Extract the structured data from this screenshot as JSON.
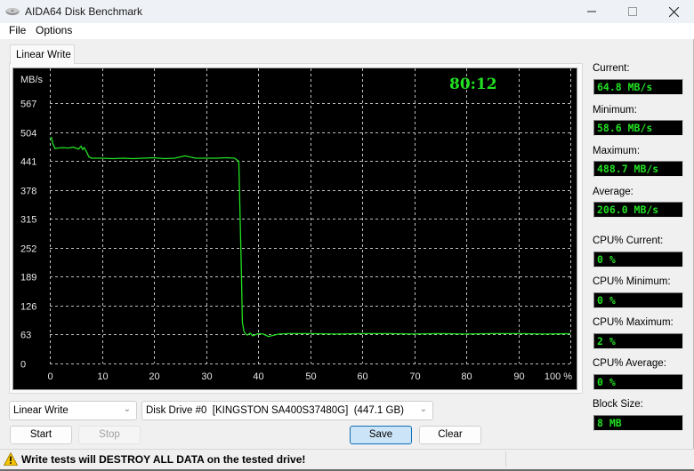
{
  "window": {
    "title": "AIDA64 Disk Benchmark",
    "controls": {
      "minimize": "—",
      "maximize": "☐",
      "close": "✕"
    }
  },
  "menu": [
    {
      "label": "File"
    },
    {
      "label": "Options"
    }
  ],
  "tab": {
    "label": "Linear Write"
  },
  "timer": "80:12",
  "stats": {
    "current": {
      "label": "Current:",
      "value": "64.8 MB/s"
    },
    "minimum": {
      "label": "Minimum:",
      "value": "58.6 MB/s"
    },
    "maximum": {
      "label": "Maximum:",
      "value": "488.7 MB/s"
    },
    "average": {
      "label": "Average:",
      "value": "206.0 MB/s"
    },
    "cpu_current": {
      "label": "CPU% Current:",
      "value": "0 %"
    },
    "cpu_minimum": {
      "label": "CPU% Minimum:",
      "value": "0 %"
    },
    "cpu_maximum": {
      "label": "CPU% Maximum:",
      "value": "2 %"
    },
    "cpu_average": {
      "label": "CPU% Average:",
      "value": "0 %"
    },
    "block_size": {
      "label": "Block Size:",
      "value": "8 MB"
    }
  },
  "controls": {
    "test_select": "Linear Write",
    "drive_select": "Disk Drive #0  [KINGSTON SA400S37480G]  (447.1 GB)",
    "start": "Start",
    "stop": "Stop",
    "save": "Save",
    "clear": "Clear"
  },
  "status": {
    "warning": "Write tests will DESTROY ALL DATA on the tested drive!"
  },
  "colors": {
    "trace": "#22e122",
    "grid": "#bfbfbf",
    "chart_bg": "#000000"
  },
  "chart_data": {
    "type": "line",
    "title": "",
    "xlabel": "",
    "ylabel": "MB/s",
    "x_unit_label": "100 %",
    "xlim": [
      0,
      100
    ],
    "ylim": [
      0,
      567
    ],
    "grid": true,
    "x_ticks": [
      "0",
      "10",
      "20",
      "30",
      "40",
      "50",
      "60",
      "70",
      "80",
      "90",
      "100 %"
    ],
    "y_ticks": [
      "0",
      "63",
      "126",
      "189",
      "252",
      "315",
      "378",
      "441",
      "504",
      "567"
    ],
    "series": [
      {
        "name": "Linear Write",
        "x": [
          0,
          0.3,
          0.6,
          1.0,
          1.5,
          2.5,
          3.5,
          4.5,
          5.5,
          6.0,
          6.3,
          6.6,
          7.0,
          7.5,
          8.0,
          10,
          12,
          14,
          16,
          18,
          20,
          22,
          24,
          26,
          28,
          30,
          32,
          34,
          35.5,
          36.3,
          36.6,
          36.8,
          37.0,
          37.3,
          37.6,
          38.0,
          38.5,
          39.0,
          40.0,
          41.0,
          42.0,
          44.0,
          46,
          50,
          55,
          60,
          65,
          70,
          75,
          80,
          85,
          90,
          95,
          100
        ],
        "y": [
          490,
          492,
          478,
          468,
          469,
          470,
          469,
          471,
          467,
          473,
          466,
          470,
          462,
          450,
          447,
          447,
          446,
          447,
          446,
          447,
          448,
          446,
          447,
          452,
          447,
          447,
          447,
          448,
          447,
          440,
          300,
          200,
          90,
          70,
          64,
          62,
          66,
          60,
          65,
          64,
          58.6,
          64,
          65,
          65,
          64,
          65,
          65,
          64,
          65,
          64,
          65,
          65,
          64,
          64.8
        ]
      }
    ]
  }
}
